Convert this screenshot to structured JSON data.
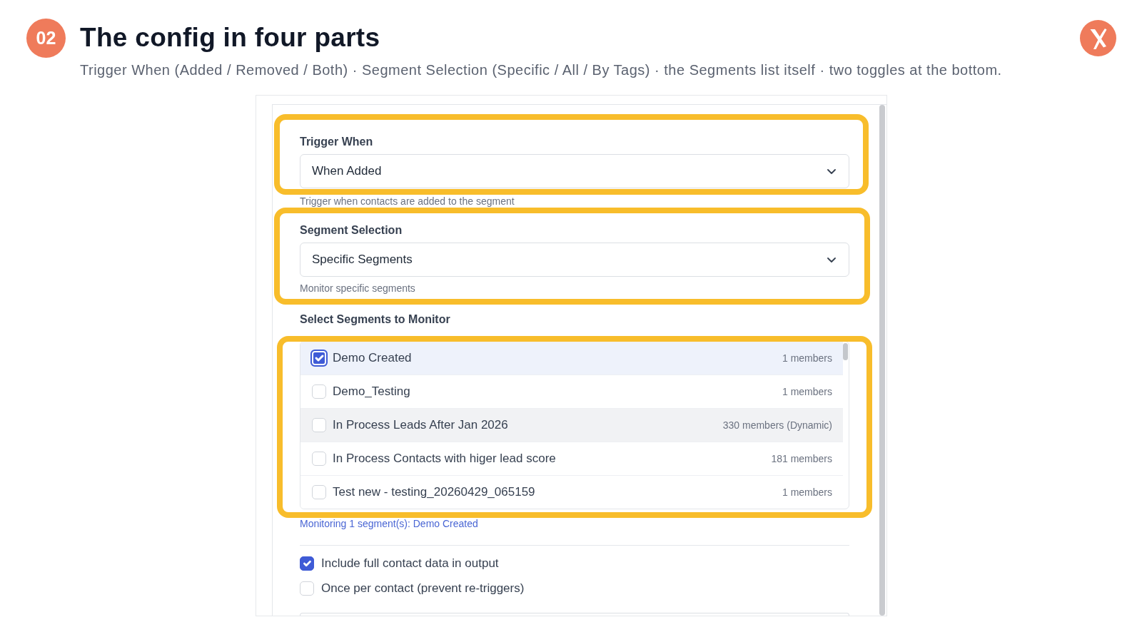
{
  "slide": {
    "number": "02",
    "title": "The config in four parts",
    "subtitle": "Trigger When (Added / Removed / Both) · Segment Selection (Specific / All / By Tags) · the Segments list itself · two toggles at the bottom."
  },
  "screenshot": {
    "trigger_when": {
      "label": "Trigger When",
      "value": "When Added",
      "help": "Trigger when contacts are added to the segment",
      "highlighted": true
    },
    "segment_selection": {
      "label": "Segment Selection",
      "value": "Specific Segments",
      "help": "Monitor specific segments",
      "highlighted": true
    },
    "segments": {
      "label": "Select Segments to Monitor",
      "highlighted": true,
      "items": [
        {
          "name": "Demo Created",
          "members": "1 members",
          "checked": true,
          "focused": true,
          "hovered": false
        },
        {
          "name": "Demo_Testing",
          "members": "1 members",
          "checked": false,
          "focused": false,
          "hovered": false
        },
        {
          "name": "In Process Leads After Jan 2026",
          "members": "330 members (Dynamic)",
          "checked": false,
          "focused": false,
          "hovered": true
        },
        {
          "name": "In Process Contacts with higer lead score",
          "members": "181 members",
          "checked": false,
          "focused": false,
          "hovered": false
        },
        {
          "name": "Test new - testing_20260429_065159",
          "members": "1 members",
          "checked": false,
          "focused": false,
          "hovered": false
        }
      ]
    },
    "summary": "Monitoring 1 segment(s): Demo Created",
    "options": [
      {
        "label": "Include full contact data in output",
        "checked": true
      },
      {
        "label": "Once per contact (prevent re-triggers)",
        "checked": false
      }
    ]
  }
}
